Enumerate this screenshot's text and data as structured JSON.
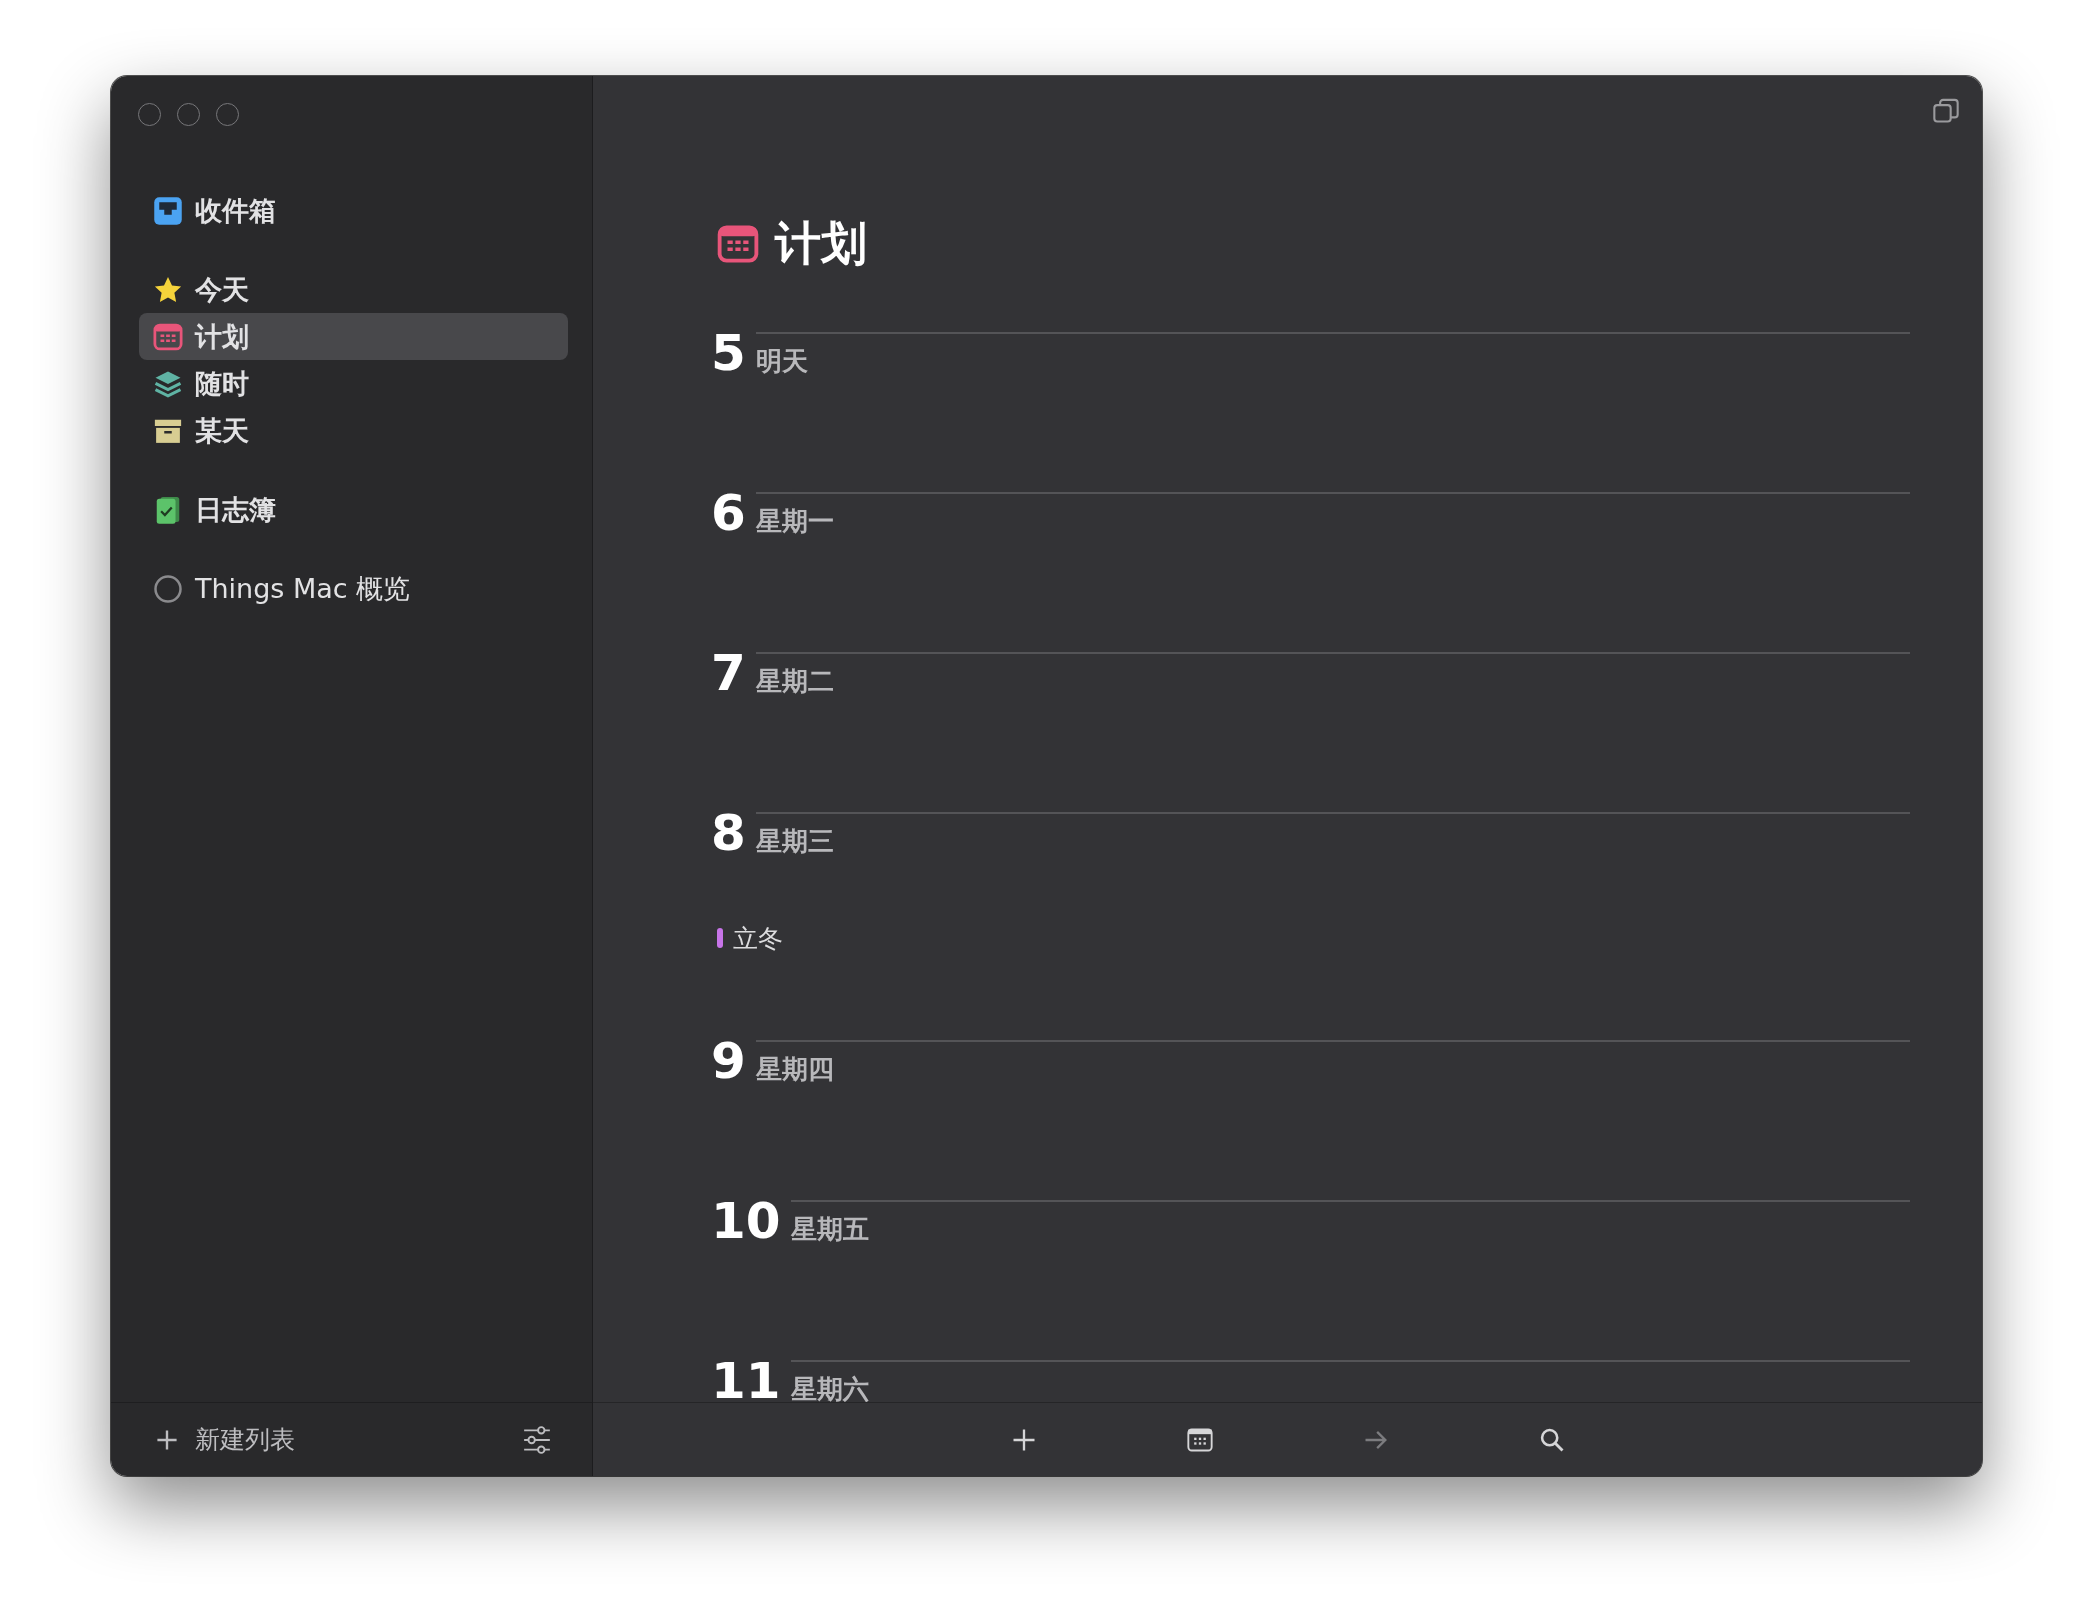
{
  "sidebar": {
    "groups": [
      {
        "items": [
          {
            "kind": "inbox",
            "label": "收件箱",
            "selected": false
          }
        ]
      },
      {
        "items": [
          {
            "kind": "today",
            "label": "今天",
            "selected": false
          },
          {
            "kind": "upcoming",
            "label": "计划",
            "selected": true
          },
          {
            "kind": "anytime",
            "label": "随时",
            "selected": false
          },
          {
            "kind": "someday",
            "label": "某天",
            "selected": false
          }
        ]
      },
      {
        "items": [
          {
            "kind": "logbook",
            "label": "日志簿",
            "selected": false
          }
        ]
      },
      {
        "items": [
          {
            "kind": "project",
            "label": "Things Mac 概览",
            "selected": false
          }
        ]
      }
    ],
    "new_list_button": "新建列表"
  },
  "main": {
    "title": "计划",
    "days": [
      {
        "number": "5",
        "name": "明天"
      },
      {
        "number": "6",
        "name": "星期一"
      },
      {
        "number": "7",
        "name": "星期二"
      },
      {
        "number": "8",
        "name": "星期三",
        "events": [
          {
            "title": "立冬",
            "color": "#c774e8"
          }
        ]
      },
      {
        "number": "9",
        "name": "星期四"
      },
      {
        "number": "10",
        "name": "星期五"
      },
      {
        "number": "11",
        "name": "星期六"
      }
    ],
    "toolbar": [
      {
        "kind": "add",
        "disabled": false
      },
      {
        "kind": "calendar",
        "disabled": false
      },
      {
        "kind": "move",
        "disabled": true
      },
      {
        "kind": "search",
        "disabled": false
      }
    ]
  }
}
